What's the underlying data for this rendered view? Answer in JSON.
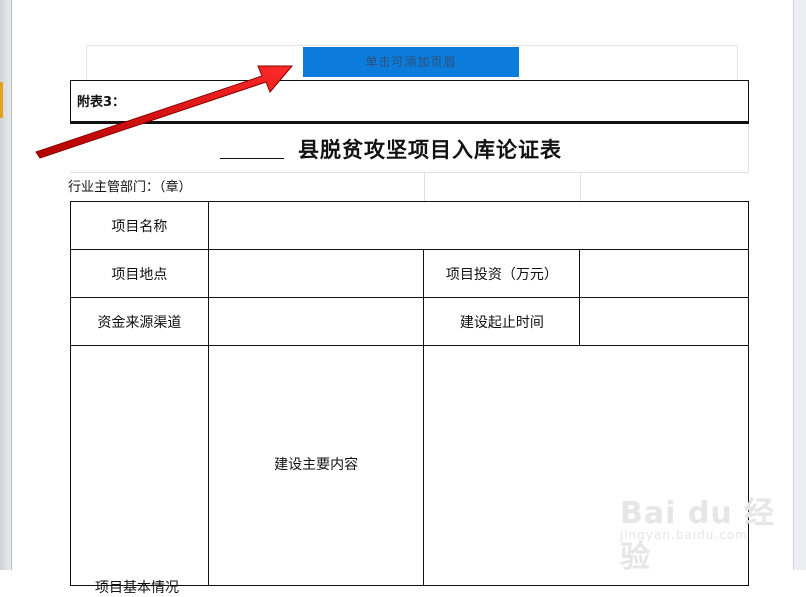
{
  "header": {
    "add_header_button": "单击可添加页眉"
  },
  "form": {
    "attachment_label": "附表3：",
    "title_blank": "______",
    "title": "县脱贫攻坚项目入库论证表",
    "department_label": "行业主管部门：（章）",
    "rows": {
      "project_name": "项目名称",
      "project_location": "项目地点",
      "project_investment": "项目投资（万元）",
      "funding_source": "资金来源渠道",
      "construction_period": "建设起止时间",
      "main_content": "建设主要内容",
      "basic_situation": "项目基本情况"
    }
  },
  "watermark": {
    "logo": "Bai du 经验",
    "url": "jingyan.baidu.com"
  }
}
